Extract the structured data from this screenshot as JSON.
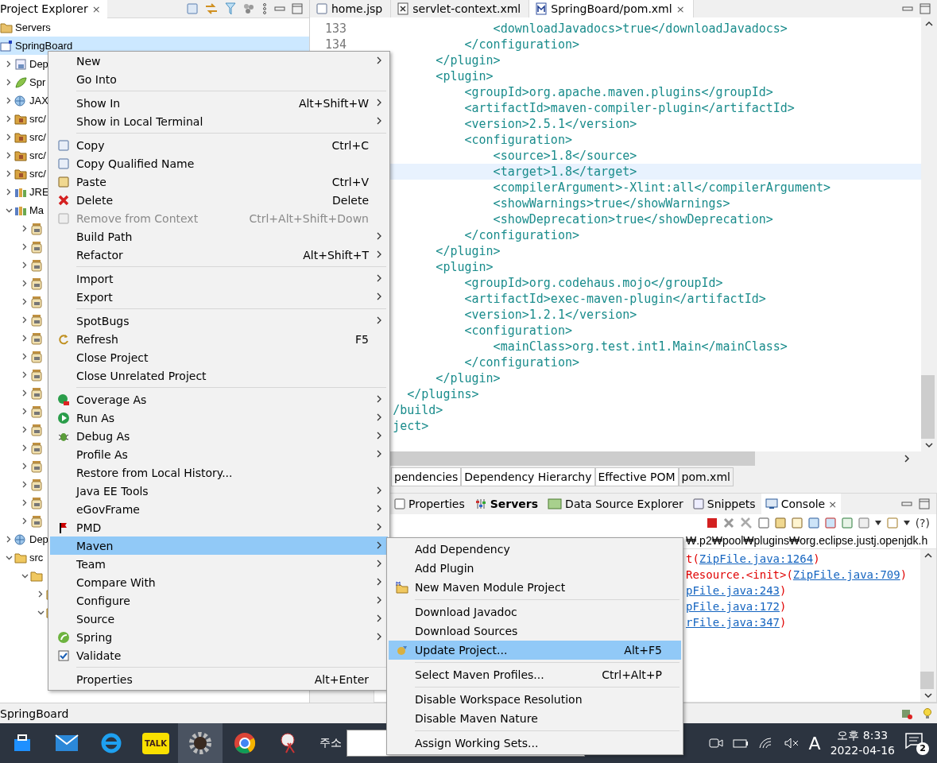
{
  "explorer": {
    "title": "Project Explorer",
    "close": "×",
    "tree": [
      {
        "kind": "servers",
        "label": "Servers",
        "selected": false
      },
      {
        "kind": "project",
        "label": "SpringBoard",
        "selected": true,
        "children": [
          {
            "kind": "deploy",
            "label": "Dep",
            "selected": false,
            "expanded": false
          },
          {
            "kind": "leaf",
            "label": "Spr",
            "selected": false,
            "expanded": false
          },
          {
            "kind": "web",
            "label": "JAX",
            "selected": false,
            "expanded": false
          },
          {
            "kind": "src",
            "label": "src/",
            "selected": false,
            "expanded": false
          },
          {
            "kind": "src",
            "label": "src/",
            "selected": false,
            "expanded": false
          },
          {
            "kind": "src",
            "label": "src/",
            "selected": false,
            "expanded": false
          },
          {
            "kind": "src",
            "label": "src/",
            "selected": false,
            "expanded": false
          },
          {
            "kind": "lib",
            "label": "JRE",
            "selected": false,
            "expanded": false
          },
          {
            "kind": "lib",
            "label": "Ma",
            "selected": false,
            "expanded": true,
            "children": [
              {
                "kind": "jar",
                "selected": false,
                "expanded": false
              },
              {
                "kind": "jar",
                "selected": false,
                "expanded": false
              },
              {
                "kind": "jar",
                "selected": false,
                "expanded": false
              },
              {
                "kind": "jar",
                "selected": false,
                "expanded": false
              },
              {
                "kind": "jar",
                "selected": false,
                "expanded": false
              },
              {
                "kind": "jar",
                "selected": false,
                "expanded": false
              },
              {
                "kind": "jar",
                "selected": false,
                "expanded": false
              },
              {
                "kind": "jar",
                "selected": false,
                "expanded": false
              },
              {
                "kind": "jar",
                "selected": false,
                "expanded": false
              },
              {
                "kind": "jar",
                "selected": false,
                "expanded": false
              },
              {
                "kind": "jar",
                "selected": false,
                "expanded": false
              },
              {
                "kind": "jar",
                "selected": false,
                "expanded": false
              },
              {
                "kind": "jar",
                "selected": false,
                "expanded": false
              },
              {
                "kind": "jar",
                "selected": false,
                "expanded": false
              },
              {
                "kind": "jar",
                "selected": false,
                "expanded": false
              },
              {
                "kind": "jar",
                "selected": false,
                "expanded": false
              },
              {
                "kind": "jar",
                "selected": false,
                "expanded": false
              }
            ]
          },
          {
            "kind": "web",
            "label": "Dep",
            "selected": false,
            "expanded": false
          },
          {
            "kind": "folder",
            "label": "src",
            "selected": false,
            "expanded": true,
            "children": [
              {
                "kind": "folder",
                "selected": false,
                "expanded": true,
                "children": [
                  {
                    "kind": "folder",
                    "selected": false,
                    "expanded": false
                  },
                  {
                    "kind": "folder",
                    "selected": false,
                    "expanded": true
                  }
                ]
              }
            ]
          }
        ]
      }
    ]
  },
  "editor": {
    "tabs": [
      {
        "label": "home.jsp",
        "kind": "jsp",
        "selected": false
      },
      {
        "label": "servlet-context.xml",
        "kind": "xml",
        "selected": false
      },
      {
        "label": "SpringBoard/pom.xml",
        "kind": "pom",
        "selected": true
      }
    ],
    "close": "×",
    "lines": [
      {
        "number": "133",
        "code": "                    <downloadJavadocs>true</downloadJavadocs>",
        "current": false
      },
      {
        "number": "134",
        "code": "                </configuration>",
        "current": false
      },
      {
        "code": "            </plugin>",
        "current": false
      },
      {
        "code": "            <plugin>",
        "current": false
      },
      {
        "code": "                <groupId>org.apache.maven.plugins</groupId>",
        "current": false
      },
      {
        "code": "                <artifactId>maven-compiler-plugin</artifactId>",
        "current": false
      },
      {
        "code": "                <version>2.5.1</version>",
        "current": false
      },
      {
        "code": "                <configuration>",
        "current": false
      },
      {
        "code": "                    <source>1.8</source>",
        "current": false
      },
      {
        "code": "                    <target>1.8</target>",
        "current": true
      },
      {
        "code": "                    <compilerArgument>-Xlint:all</compilerArgument>",
        "current": false
      },
      {
        "code": "                    <showWarnings>true</showWarnings>",
        "current": false
      },
      {
        "code": "                    <showDeprecation>true</showDeprecation>",
        "current": false
      },
      {
        "code": "                </configuration>",
        "current": false
      },
      {
        "code": "            </plugin>",
        "current": false
      },
      {
        "code": "            <plugin>",
        "current": false
      },
      {
        "code": "                <groupId>org.codehaus.mojo</groupId>",
        "current": false
      },
      {
        "code": "                <artifactId>exec-maven-plugin</artifactId>",
        "current": false
      },
      {
        "code": "                <version>1.2.1</version>",
        "current": false
      },
      {
        "code": "                <configuration>",
        "current": false
      },
      {
        "code": "                    <mainClass>org.test.int1.Main</mainClass>",
        "current": false
      },
      {
        "code": "                </configuration>",
        "current": false
      },
      {
        "code": "            </plugin>",
        "current": false
      },
      {
        "code": "        </plugins>",
        "current": false
      },
      {
        "code": "      /build>",
        "current": false
      },
      {
        "code": "      ject>",
        "current": false
      }
    ],
    "bottom_tabs": [
      {
        "label": "pendencies",
        "selected": false
      },
      {
        "label": "Dependency Hierarchy",
        "selected": false
      },
      {
        "label": "Effective POM",
        "selected": false
      },
      {
        "label": "pom.xml",
        "selected": true
      }
    ]
  },
  "views": {
    "tabs": [
      {
        "label": "Properties",
        "kind": "properties",
        "selected": false
      },
      {
        "label": "Servers",
        "kind": "servers",
        "selected": false
      },
      {
        "label": "Data Source Explorer",
        "kind": "datasource",
        "selected": false
      },
      {
        "label": "Snippets",
        "kind": "snippets",
        "selected": false
      },
      {
        "label": "Console",
        "kind": "console",
        "selected": true
      }
    ],
    "close": "×",
    "help": "(?)",
    "console_header": "₩.p2₩pool₩plugins₩org.eclipse.justj.openjdk.h",
    "console_lines": [
      [
        {
          "kind": "error",
          "text": "t("
        },
        {
          "kind": "link",
          "text": "ZipFile.java:1264"
        },
        {
          "kind": "error",
          "text": ")"
        }
      ],
      [
        {
          "kind": "error",
          "text": "Resource.<init>("
        },
        {
          "kind": "link",
          "text": "ZipFile.java:709"
        },
        {
          "kind": "error",
          "text": ")"
        }
      ],
      [
        {
          "kind": "link",
          "text": "pFile.java:243"
        },
        {
          "kind": "error",
          "text": ")"
        }
      ],
      [
        {
          "kind": "link",
          "text": "pFile.java:172"
        },
        {
          "kind": "error",
          "text": ")"
        }
      ],
      [
        {
          "kind": "link",
          "text": "rFile.java:347"
        },
        {
          "kind": "error",
          "text": ")"
        }
      ]
    ]
  },
  "context_menu": [
    {
      "kind": "item",
      "label": "New",
      "submenu": true,
      "selected": false,
      "disabled": false
    },
    {
      "kind": "item",
      "label": "Go Into",
      "selected": false,
      "disabled": false
    },
    {
      "kind": "separator"
    },
    {
      "kind": "item",
      "label": "Show In",
      "shortcut": "Alt+Shift+W",
      "submenu": true,
      "selected": false,
      "disabled": false
    },
    {
      "kind": "item",
      "label": "Show in Local Terminal",
      "submenu": true,
      "selected": false,
      "disabled": false
    },
    {
      "kind": "separator"
    },
    {
      "kind": "item",
      "label": "Copy",
      "shortcut": "Ctrl+C",
      "selected": false,
      "disabled": false
    },
    {
      "kind": "item",
      "label": "Copy Qualified Name",
      "selected": false,
      "disabled": false
    },
    {
      "kind": "item",
      "label": "Paste",
      "shortcut": "Ctrl+V",
      "selected": false,
      "disabled": false
    },
    {
      "kind": "item",
      "label": "Delete",
      "shortcut": "Delete",
      "selected": false,
      "disabled": false
    },
    {
      "kind": "item",
      "label": "Remove from Context",
      "shortcut": "Ctrl+Alt+Shift+Down",
      "selected": false,
      "disabled": true
    },
    {
      "kind": "item",
      "label": "Build Path",
      "submenu": true,
      "selected": false,
      "disabled": false
    },
    {
      "kind": "item",
      "label": "Refactor",
      "shortcut": "Alt+Shift+T",
      "submenu": true,
      "selected": false,
      "disabled": false
    },
    {
      "kind": "separator"
    },
    {
      "kind": "item",
      "label": "Import",
      "submenu": true,
      "selected": false,
      "disabled": false
    },
    {
      "kind": "item",
      "label": "Export",
      "submenu": true,
      "selected": false,
      "disabled": false
    },
    {
      "kind": "separator"
    },
    {
      "kind": "item",
      "label": "SpotBugs",
      "submenu": true,
      "selected": false,
      "disabled": false
    },
    {
      "kind": "item",
      "label": "Refresh",
      "shortcut": "F5",
      "selected": false,
      "disabled": false
    },
    {
      "kind": "item",
      "label": "Close Project",
      "selected": false,
      "disabled": false
    },
    {
      "kind": "item",
      "label": "Close Unrelated Project",
      "selected": false,
      "disabled": false
    },
    {
      "kind": "separator"
    },
    {
      "kind": "item",
      "label": "Coverage As",
      "submenu": true,
      "selected": false,
      "disabled": false
    },
    {
      "kind": "item",
      "label": "Run As",
      "submenu": true,
      "selected": false,
      "disabled": false
    },
    {
      "kind": "item",
      "label": "Debug As",
      "submenu": true,
      "selected": false,
      "disabled": false
    },
    {
      "kind": "item",
      "label": "Profile As",
      "submenu": true,
      "selected": false,
      "disabled": false
    },
    {
      "kind": "item",
      "label": "Restore from Local History...",
      "selected": false,
      "disabled": false
    },
    {
      "kind": "item",
      "label": "Java EE Tools",
      "submenu": true,
      "selected": false,
      "disabled": false
    },
    {
      "kind": "item",
      "label": "eGovFrame",
      "submenu": true,
      "selected": false,
      "disabled": false
    },
    {
      "kind": "item",
      "label": "PMD",
      "submenu": true,
      "selected": false,
      "disabled": false
    },
    {
      "kind": "item",
      "label": "Maven",
      "submenu": true,
      "selected": true,
      "disabled": false
    },
    {
      "kind": "item",
      "label": "Team",
      "submenu": true,
      "selected": false,
      "disabled": false
    },
    {
      "kind": "item",
      "label": "Compare With",
      "submenu": true,
      "selected": false,
      "disabled": false
    },
    {
      "kind": "item",
      "label": "Configure",
      "submenu": true,
      "selected": false,
      "disabled": false
    },
    {
      "kind": "item",
      "label": "Source",
      "submenu": true,
      "selected": false,
      "disabled": false
    },
    {
      "kind": "item",
      "label": "Spring",
      "submenu": true,
      "selected": false,
      "disabled": false
    },
    {
      "kind": "item",
      "label": "Validate",
      "selected": false,
      "disabled": false
    },
    {
      "kind": "separator"
    },
    {
      "kind": "item",
      "label": "Properties",
      "shortcut": "Alt+Enter",
      "selected": false,
      "disabled": false
    }
  ],
  "maven_submenu": [
    {
      "kind": "item",
      "label": "Add Dependency",
      "selected": false,
      "disabled": false
    },
    {
      "kind": "item",
      "label": "Add Plugin",
      "selected": false,
      "disabled": false
    },
    {
      "kind": "item",
      "label": "New Maven Module Project",
      "selected": false,
      "disabled": false
    },
    {
      "kind": "separator"
    },
    {
      "kind": "item",
      "label": "Download Javadoc",
      "selected": false,
      "disabled": false
    },
    {
      "kind": "item",
      "label": "Download Sources",
      "selected": false,
      "disabled": false
    },
    {
      "kind": "item",
      "label": "Update Project...",
      "shortcut": "Alt+F5",
      "selected": true,
      "disabled": false
    },
    {
      "kind": "separator"
    },
    {
      "kind": "item",
      "label": "Select Maven Profiles...",
      "shortcut": "Ctrl+Alt+P",
      "selected": false,
      "disabled": false
    },
    {
      "kind": "separator"
    },
    {
      "kind": "item",
      "label": "Disable Workspace Resolution",
      "selected": false,
      "disabled": false
    },
    {
      "kind": "item",
      "label": "Disable Maven Nature",
      "selected": false,
      "disabled": false
    },
    {
      "kind": "separator"
    },
    {
      "kind": "item",
      "label": "Assign Working Sets...",
      "selected": false,
      "disabled": false
    }
  ],
  "status_bar": {
    "text": "SpringBoard"
  },
  "taskbar": {
    "talk_label": "TALK",
    "address_label": "주소",
    "keyboard_mode": "A",
    "time": "오후 8:33",
    "date": "2022-04-16",
    "notification_count": "2"
  }
}
